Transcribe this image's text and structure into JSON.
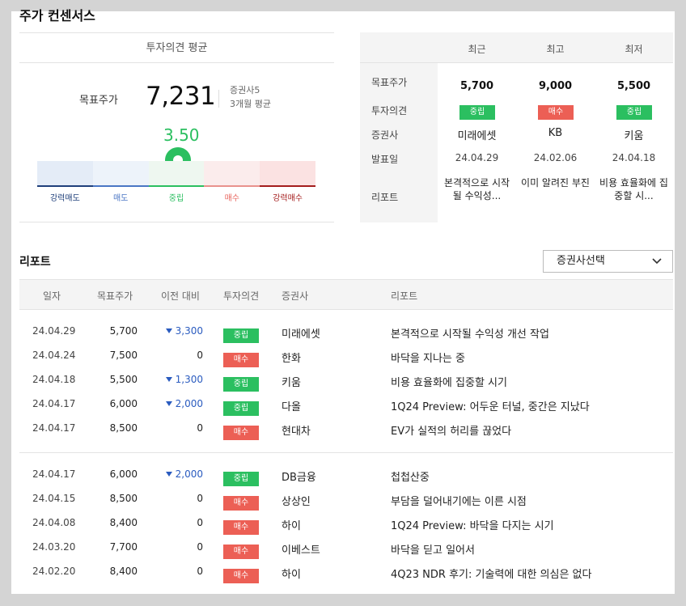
{
  "title": "주가 컨센서스",
  "consensus": {
    "header": "투자의견 평균",
    "target_label": "목표주가",
    "target_value": "7,231",
    "broker_count": "증권사5",
    "period": "3개월 평균",
    "score": "3.50",
    "scale": [
      "강력매도",
      "매도",
      "중립",
      "매수",
      "강력매수"
    ],
    "colors": {
      "neutral": "#2bbf60",
      "buy": "#ec5f55",
      "down": "#2a5bbf"
    }
  },
  "summary": {
    "row_labels": [
      "목표주가",
      "투자의견",
      "증권사",
      "발표일",
      "리포트"
    ],
    "columns": [
      {
        "header": "최근",
        "price": "5,700",
        "opinion": "중립",
        "opinion_type": "neutral",
        "broker": "미래에셋",
        "date": "24.04.29",
        "report": "본격적으로 시작될 수익성..."
      },
      {
        "header": "최고",
        "price": "9,000",
        "opinion": "매수",
        "opinion_type": "buy",
        "broker": "KB",
        "date": "24.02.06",
        "report": "이미 알려진 부진"
      },
      {
        "header": "최저",
        "price": "5,500",
        "opinion": "중립",
        "opinion_type": "neutral",
        "broker": "키움",
        "date": "24.04.18",
        "report": "비용 효율화에 집중할 시..."
      }
    ]
  },
  "reports": {
    "title": "리포트",
    "select_label": "증권사선택",
    "headers": [
      "일자",
      "목표주가",
      "이전 대비",
      "투자의견",
      "증권사",
      "리포트"
    ],
    "rows": [
      {
        "date": "24.04.29",
        "price": "5,700",
        "change": "3,300",
        "dir": "down",
        "opinion": "중립",
        "type": "neutral",
        "broker": "미래에셋",
        "report": "본격적으로 시작될 수익성 개선 작업"
      },
      {
        "date": "24.04.24",
        "price": "7,500",
        "change": "0",
        "dir": "zero",
        "opinion": "매수",
        "type": "buy",
        "broker": "한화",
        "report": "바닥을 지나는 중"
      },
      {
        "date": "24.04.18",
        "price": "5,500",
        "change": "1,300",
        "dir": "down",
        "opinion": "중립",
        "type": "neutral",
        "broker": "키움",
        "report": "비용 효율화에 집중할 시기"
      },
      {
        "date": "24.04.17",
        "price": "6,000",
        "change": "2,000",
        "dir": "down",
        "opinion": "중립",
        "type": "neutral",
        "broker": "다올",
        "report": "1Q24 Preview: 어두운 터널, 중간은 지났다"
      },
      {
        "date": "24.04.17",
        "price": "8,500",
        "change": "0",
        "dir": "zero",
        "opinion": "매수",
        "type": "buy",
        "broker": "현대차",
        "report": "EV가 실적의 허리를 끊었다"
      },
      {
        "date": "24.04.17",
        "price": "6,000",
        "change": "2,000",
        "dir": "down",
        "opinion": "중립",
        "type": "neutral",
        "broker": "DB금융",
        "report": "첩첩산중"
      },
      {
        "date": "24.04.15",
        "price": "8,500",
        "change": "0",
        "dir": "zero",
        "opinion": "매수",
        "type": "buy",
        "broker": "상상인",
        "report": "부담을 덜어내기에는 이른 시점"
      },
      {
        "date": "24.04.08",
        "price": "8,400",
        "change": "0",
        "dir": "zero",
        "opinion": "매수",
        "type": "buy",
        "broker": "하이",
        "report": "1Q24 Preview: 바닥을 다지는 시기"
      },
      {
        "date": "24.03.20",
        "price": "7,700",
        "change": "0",
        "dir": "zero",
        "opinion": "매수",
        "type": "buy",
        "broker": "이베스트",
        "report": "바닥을 딛고 일어서"
      },
      {
        "date": "24.02.20",
        "price": "8,400",
        "change": "0",
        "dir": "zero",
        "opinion": "매수",
        "type": "buy",
        "broker": "하이",
        "report": "4Q23 NDR 후기: 기술력에 대한 의심은 없다"
      }
    ]
  }
}
